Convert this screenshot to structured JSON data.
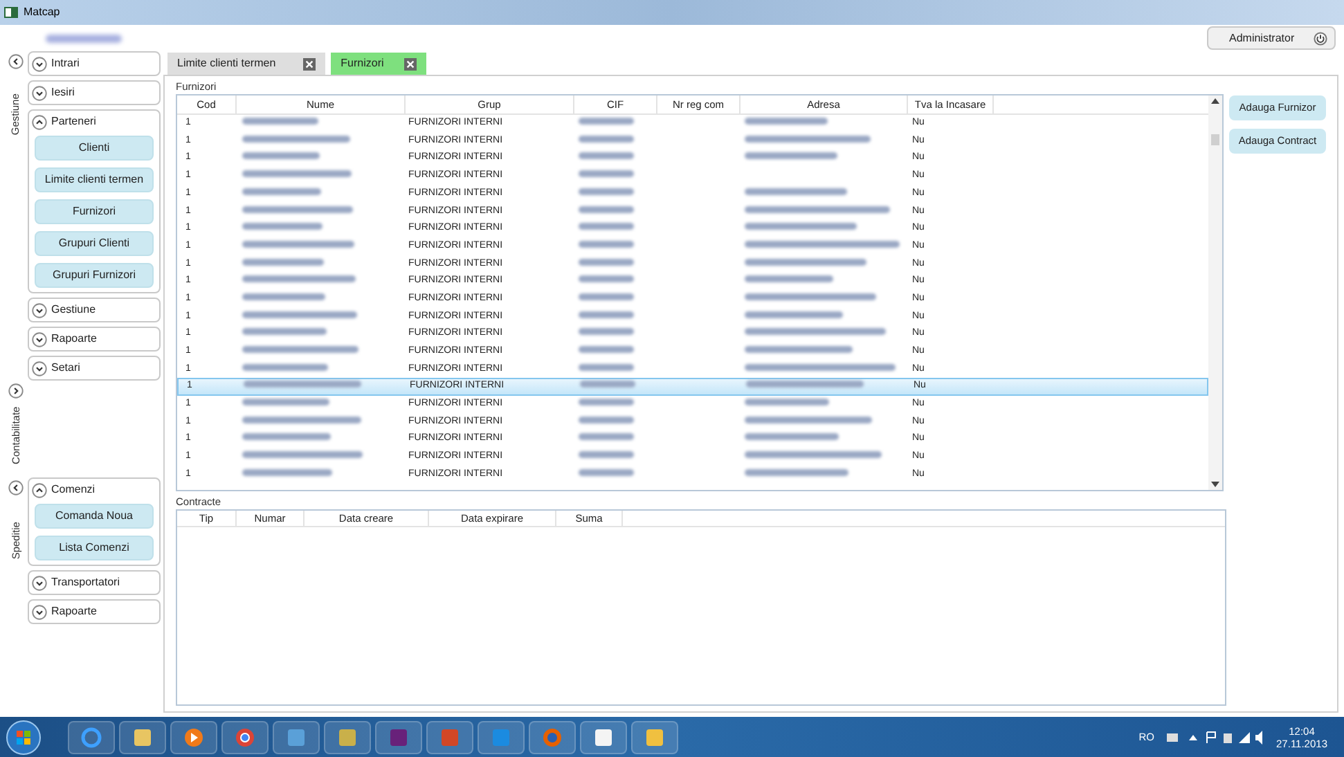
{
  "window": {
    "title": "Matcap"
  },
  "user_button": {
    "label": "Administrator"
  },
  "sidebar": {
    "panels": [
      {
        "tab": "Gestiune",
        "expanded": true,
        "sections": [
          {
            "label": "Intrari",
            "expanded": false
          },
          {
            "label": "Iesiri",
            "expanded": false
          },
          {
            "label": "Parteneri",
            "expanded": true,
            "items": [
              "Clienti",
              "Limite clienti termen",
              "Furnizori",
              "Grupuri Clienti",
              "Grupuri Furnizori"
            ]
          },
          {
            "label": "Gestiune",
            "expanded": false
          },
          {
            "label": "Rapoarte",
            "expanded": false
          },
          {
            "label": "Setari",
            "expanded": false
          }
        ]
      },
      {
        "tab": "Contabilitate",
        "expanded": false
      },
      {
        "tab": "Speditie",
        "expanded": true,
        "sections": [
          {
            "label": "Comenzi",
            "expanded": true,
            "items": [
              "Comanda Noua",
              "Lista Comenzi"
            ]
          },
          {
            "label": "Transportatori",
            "expanded": false
          },
          {
            "label": "Rapoarte",
            "expanded": false
          }
        ]
      }
    ]
  },
  "tabs": [
    {
      "label": "Limite clienti termen",
      "selected": false
    },
    {
      "label": "Furnizori",
      "selected": true
    }
  ],
  "suppliers": {
    "title": "Furnizori",
    "columns": [
      "Cod",
      "Nume",
      "Grup",
      "CIF",
      "Nr reg com",
      "Adresa",
      "Tva la Incasare"
    ],
    "rows": [
      {
        "cod": "1",
        "grup": "FURNIZORI INTERNI",
        "has_address": true,
        "tva": "Nu",
        "selected": false
      },
      {
        "cod": "1",
        "grup": "FURNIZORI INTERNI",
        "has_address": true,
        "tva": "Nu",
        "selected": false
      },
      {
        "cod": "1",
        "grup": "FURNIZORI INTERNI",
        "has_address": true,
        "tva": "Nu",
        "selected": false
      },
      {
        "cod": "1",
        "grup": "FURNIZORI INTERNI",
        "has_address": false,
        "tva": "Nu",
        "selected": false
      },
      {
        "cod": "1",
        "grup": "FURNIZORI INTERNI",
        "has_address": true,
        "tva": "Nu",
        "selected": false
      },
      {
        "cod": "1",
        "grup": "FURNIZORI INTERNI",
        "has_address": true,
        "tva": "Nu",
        "selected": false
      },
      {
        "cod": "1",
        "grup": "FURNIZORI INTERNI",
        "has_address": true,
        "tva": "Nu",
        "selected": false
      },
      {
        "cod": "1",
        "grup": "FURNIZORI INTERNI",
        "has_address": true,
        "tva": "Nu",
        "selected": false
      },
      {
        "cod": "1",
        "grup": "FURNIZORI INTERNI",
        "has_address": true,
        "tva": "Nu",
        "selected": false
      },
      {
        "cod": "1",
        "grup": "FURNIZORI INTERNI",
        "has_address": true,
        "tva": "Nu",
        "selected": false
      },
      {
        "cod": "1",
        "grup": "FURNIZORI INTERNI",
        "has_address": true,
        "tva": "Nu",
        "selected": false
      },
      {
        "cod": "1",
        "grup": "FURNIZORI INTERNI",
        "has_address": true,
        "tva": "Nu",
        "selected": false
      },
      {
        "cod": "1",
        "grup": "FURNIZORI INTERNI",
        "has_address": true,
        "tva": "Nu",
        "selected": false
      },
      {
        "cod": "1",
        "grup": "FURNIZORI INTERNI",
        "has_address": true,
        "tva": "Nu",
        "selected": false
      },
      {
        "cod": "1",
        "grup": "FURNIZORI INTERNI",
        "has_address": true,
        "tva": "Nu",
        "selected": false
      },
      {
        "cod": "1",
        "grup": "FURNIZORI INTERNI",
        "has_address": true,
        "tva": "Nu",
        "selected": true
      },
      {
        "cod": "1",
        "grup": "FURNIZORI INTERNI",
        "has_address": true,
        "tva": "Nu",
        "selected": false
      },
      {
        "cod": "1",
        "grup": "FURNIZORI INTERNI",
        "has_address": true,
        "tva": "Nu",
        "selected": false
      },
      {
        "cod": "1",
        "grup": "FURNIZORI INTERNI",
        "has_address": true,
        "tva": "Nu",
        "selected": false
      },
      {
        "cod": "1",
        "grup": "FURNIZORI INTERNI",
        "has_address": true,
        "tva": "Nu",
        "selected": false
      },
      {
        "cod": "1",
        "grup": "FURNIZORI INTERNI",
        "has_address": true,
        "tva": "Nu",
        "selected": false
      }
    ]
  },
  "actions": [
    "Adauga Furnizor",
    "Adauga Contract"
  ],
  "contracts": {
    "title": "Contracte",
    "columns": [
      "Tip",
      "Numar",
      "Data creare",
      "Data expirare",
      "Suma"
    ]
  },
  "taskbar": {
    "language": "RO",
    "time": "12:04",
    "date": "27.11.2013"
  }
}
